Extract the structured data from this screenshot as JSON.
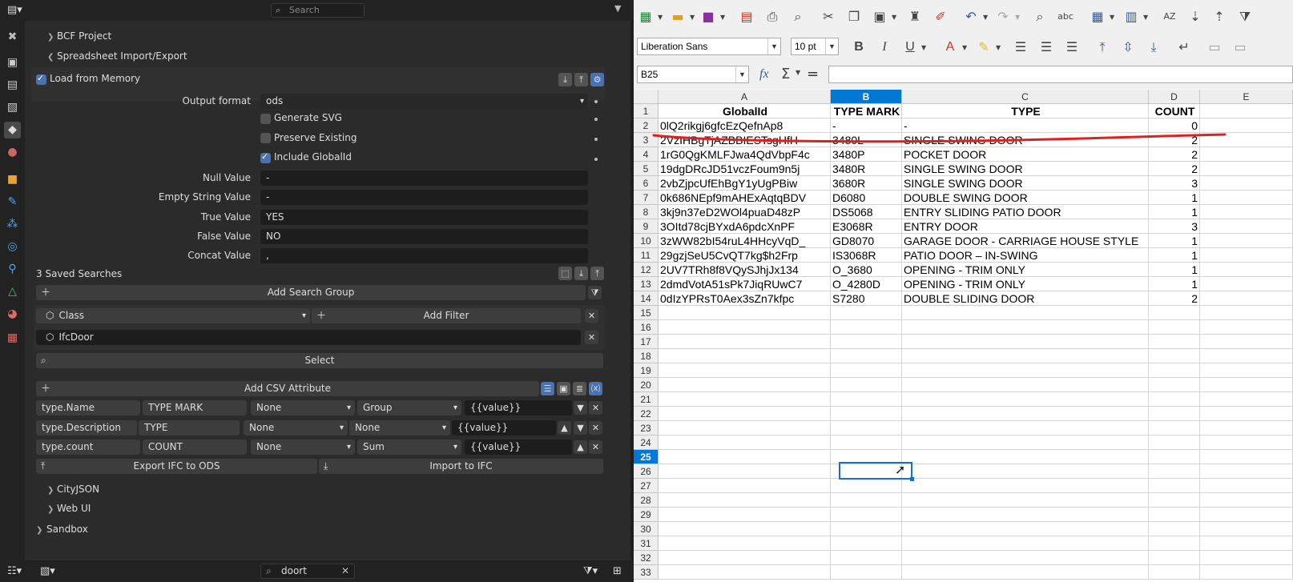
{
  "blender": {
    "header": {
      "search_placeholder": "Search"
    },
    "sections": {
      "bcf": "BCF Project",
      "spreadsheet": "Spreadsheet Import/Export",
      "cityjson": "CityJSON",
      "webui": "Web UI",
      "sandbox": "Sandbox"
    },
    "load_from_memory": "Load from Memory",
    "output_format": {
      "label": "Output format",
      "value": "ods"
    },
    "generate_svg": "Generate SVG",
    "preserve_existing": "Preserve Existing",
    "include_globalid": "Include GlobalId",
    "fields": [
      {
        "label": "Null Value",
        "value": "-"
      },
      {
        "label": "Empty String Value",
        "value": "-"
      },
      {
        "label": "True Value",
        "value": "YES"
      },
      {
        "label": "False Value",
        "value": "NO"
      },
      {
        "label": "Concat Value",
        "value": ","
      }
    ],
    "saved_searches": "3 Saved Searches",
    "add_search_group": "Add Search Group",
    "class_label": "Class",
    "add_filter": "Add Filter",
    "ifc_class": "IfcDoor",
    "select": "Select",
    "add_csv_attribute": "Add CSV Attribute",
    "csv_rows": [
      {
        "attr": "type.Name",
        "header": "TYPE MARK",
        "sort": "None",
        "group": "Group",
        "format": "{{value}}"
      },
      {
        "attr": "type.Description",
        "header": "TYPE",
        "sort": "None",
        "group": "None",
        "format": "{{value}}"
      },
      {
        "attr": "type.count",
        "header": "COUNT",
        "sort": "None",
        "group": "Sum",
        "format": "{{value}}"
      }
    ],
    "export_ifc": "Export IFC to ODS",
    "import_ifc": "Import to IFC",
    "footer_search": "doort"
  },
  "calc": {
    "font_name": "Liberation Sans",
    "font_size": "10 pt",
    "cell_ref": "B25",
    "fx": "fx",
    "sigma": "Σ",
    "equals": "=",
    "columns": [
      "A",
      "B",
      "C",
      "D",
      "E"
    ],
    "header_row": [
      "GlobalId",
      "TYPE MARK",
      "TYPE",
      "COUNT"
    ],
    "rows": [
      [
        "0lQ2rikgj6gfcEzQefnAp8",
        "-",
        "-",
        "0"
      ],
      [
        "2VzIHBgTjAZBBIESTsgHfH",
        "3480L",
        "SINGLE SWING DOOR",
        "2"
      ],
      [
        "1rG0QgKMLFJwa4QdVbpF4c",
        "3480P",
        "POCKET DOOR",
        "2"
      ],
      [
        "19dgDRcJD51vczFoum9n5j",
        "3480R",
        "SINGLE SWING DOOR",
        "2"
      ],
      [
        "2vbZjpcUfEhBgY1yUgPBiw",
        "3680R",
        "SINGLE SWING DOOR",
        "3"
      ],
      [
        "0k686NEpf9mAHExAqtqBDV",
        "D6080",
        "DOUBLE SWING DOOR",
        "1"
      ],
      [
        "3kj9n37eD2WOl4puaD48zP",
        "DS5068",
        "ENTRY SLIDING PATIO DOOR",
        "1"
      ],
      [
        "3OItd78cjBYxdA6pdcXnPF",
        "E3068R",
        "ENTRY DOOR",
        "3"
      ],
      [
        "3zWW82bI54ruL4HHcyVqD_",
        "GD8070",
        "GARAGE DOOR - CARRIAGE HOUSE STYLE",
        "1"
      ],
      [
        "29gzjSeU5CvQT7kg$h2Frp",
        "IS3068R",
        "PATIO DOOR – IN-SWING",
        "1"
      ],
      [
        "2UV7TRh8f8VQySJhjJx134",
        "O_3680",
        "OPENING - TRIM ONLY",
        "1"
      ],
      [
        "2dmdVotA51sPk7JiqRUwC7",
        "O_4280D",
        "OPENING - TRIM ONLY",
        "1"
      ],
      [
        "0dIzYPRsT0Aex3sZn7kfpc",
        "S7280",
        "DOUBLE SLIDING DOOR",
        "2"
      ]
    ],
    "row_numbers": [
      "1",
      "2",
      "3",
      "4",
      "5",
      "6",
      "7",
      "8",
      "9",
      "10",
      "11",
      "12",
      "13",
      "14",
      "15",
      "16",
      "17",
      "18",
      "19",
      "20",
      "21",
      "22",
      "23",
      "24",
      "25",
      "26",
      "27",
      "28",
      "29",
      "30",
      "31",
      "32",
      "33"
    ]
  }
}
